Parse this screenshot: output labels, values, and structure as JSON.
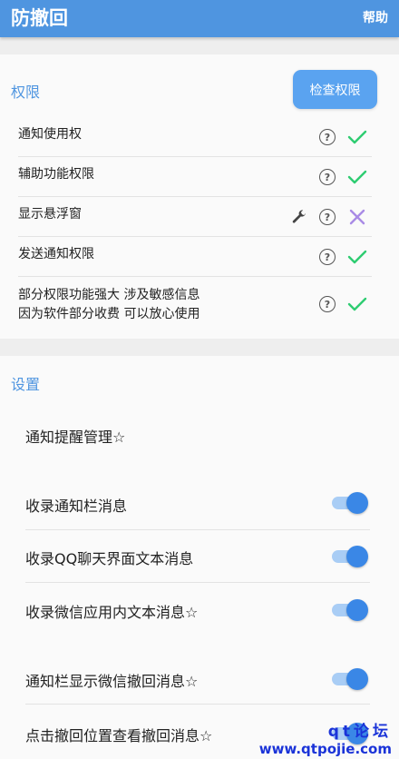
{
  "appbar": {
    "title": "防撤回",
    "help": "帮助"
  },
  "permissions": {
    "title": "权限",
    "check_button": "检查权限",
    "rows": [
      {
        "label": "通知使用权",
        "status": "ok"
      },
      {
        "label": "辅助功能权限",
        "status": "ok"
      },
      {
        "label": "显示悬浮窗",
        "status": "error"
      },
      {
        "label": "发送通知权限",
        "status": "ok"
      },
      {
        "label_line1": "部分权限功能强大 涉及敏感信息",
        "label_line2": "因为软件部分收费 可以放心使用",
        "status": "ok"
      }
    ],
    "help_glyph": "?"
  },
  "settings": {
    "title": "设置",
    "rows": [
      {
        "label": "通知提醒管理☆"
      },
      {
        "label": "收录通知栏消息",
        "toggle": true
      },
      {
        "label": "收录QQ聊天界面文本消息",
        "toggle": true
      },
      {
        "label": "收录微信应用内文本消息☆",
        "toggle": true
      },
      {
        "label": "通知栏显示微信撤回消息☆",
        "toggle": true
      },
      {
        "label": "点击撤回位置查看撤回消息☆",
        "toggle": true
      }
    ]
  },
  "watermark": {
    "top": "qt论坛",
    "bottom": "www.qtpojie.com"
  },
  "colors": {
    "accent": "#4f95e0",
    "ok": "#2ecc71",
    "error": "#a98be6",
    "toggle_on": "#3a87e6"
  }
}
